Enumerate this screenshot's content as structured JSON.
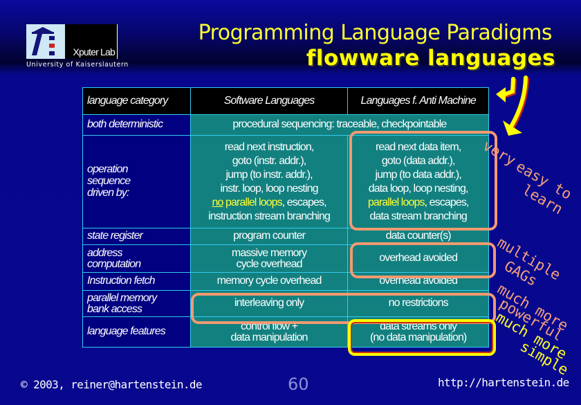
{
  "logo": {
    "lab_name": "Xputer Lab",
    "university": "University of Kaiserslautern"
  },
  "title": {
    "line1": "Programming Language  Paradigms",
    "line2": "flowware languages"
  },
  "table": {
    "header": {
      "category": "language category",
      "software": "Software Languages",
      "anti": "Languages f. Anti Machine"
    },
    "rows": {
      "deterministic": {
        "category": "both deterministic",
        "merged": "procedural sequencing: traceable, checkpointable"
      },
      "operation": {
        "category_lines": [
          "operation",
          "sequence",
          "driven by:"
        ],
        "software_lines": [
          "read next instruction,",
          "goto (instr. addr.),",
          "jump  (to instr. addr.),",
          "instr. loop, loop nesting"
        ],
        "software_last_no": "no",
        "software_last_parallel": " parallel loops",
        "software_last_rest": ", escapes,",
        "software_final": "instruction stream branching",
        "anti_lines": [
          "read next data item,",
          "goto (data addr.),",
          "jump (to data addr.),",
          "data loop,  loop nesting,"
        ],
        "anti_last_parallel": "parallel loops",
        "anti_last_rest": ", escapes,",
        "anti_final": "data stream branching"
      },
      "state_register": {
        "category": "state register",
        "software": "program counter",
        "anti": "data counter(s)"
      },
      "address": {
        "category_lines": [
          "address",
          "computation"
        ],
        "software_lines": [
          "massive memory",
          "cycle overhead"
        ],
        "anti": "overhead avoided"
      },
      "fetch": {
        "category": "Instruction fetch",
        "software": "memory cycle overhead",
        "anti": "overhead avoided"
      },
      "parallel": {
        "category_lines": [
          "parallel memory",
          "bank access"
        ],
        "software": "interleaving only",
        "anti": "no restrictions"
      },
      "features": {
        "category": "language features",
        "software_lines": [
          "control flow +",
          "data manipulation"
        ],
        "anti_lines": [
          "data streams only",
          "(no data manipulation)"
        ]
      }
    }
  },
  "annotations": {
    "easy": [
      "very",
      "easy to",
      "learn"
    ],
    "gags": [
      "multiple",
      "GAGs"
    ],
    "powerful": [
      "much more",
      "powerful"
    ],
    "simple": [
      "much more",
      "simple"
    ]
  },
  "footer": {
    "copyright": "© 2003, reiner@hartenstein.de",
    "page_number": "60",
    "url": "http://hartenstein.de"
  },
  "colors": {
    "background": "#08088f",
    "title": "#ffff33",
    "header_cell": "#000000",
    "category_cell": "#000080",
    "content_cell": "#138080",
    "grid_line": "#33ccee",
    "highlight_ring": "#f29a70",
    "simple_ring": "#ffff00"
  }
}
